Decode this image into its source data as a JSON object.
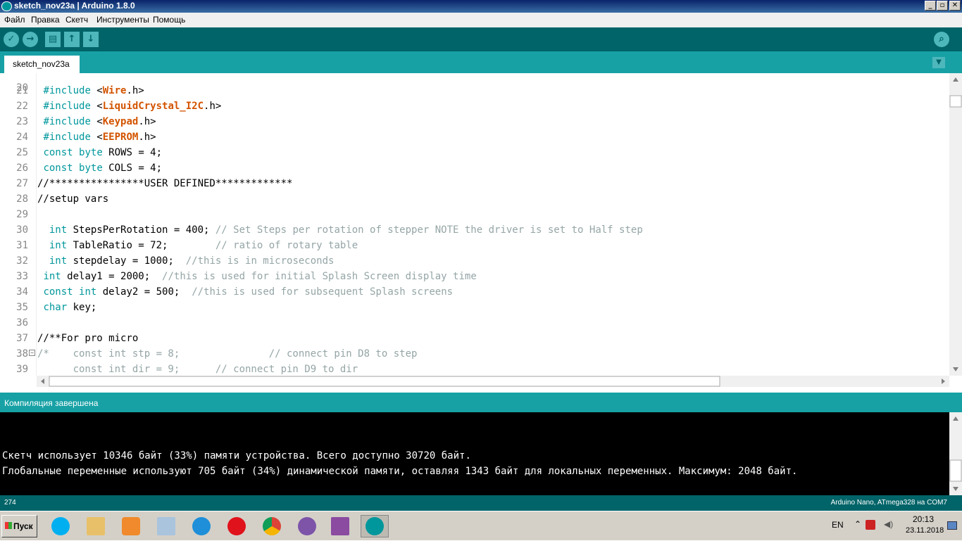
{
  "window": {
    "title": "sketch_nov23a | Arduino 1.8.0"
  },
  "menu": [
    "Файл",
    "Правка",
    "Скетч",
    "Инструменты",
    "Помощь"
  ],
  "toolbar": {
    "buttons": [
      "verify-icon",
      "upload-icon",
      "new-icon",
      "open-icon",
      "save-icon"
    ],
    "serial_monitor_icon": "magnifier-icon"
  },
  "tabs": {
    "active": "sketch_nov23a"
  },
  "editor": {
    "partial_top_line": "20",
    "lines": [
      {
        "n": "21",
        "code": " #include <Wire.h>"
      },
      {
        "n": "22",
        "code": " #include <LiquidCrystal_I2C.h>"
      },
      {
        "n": "23",
        "code": " #include <Keypad.h>"
      },
      {
        "n": "24",
        "code": " #include <EEPROM.h>"
      },
      {
        "n": "25",
        "code": " const byte ROWS = 4;"
      },
      {
        "n": "26",
        "code": " const byte COLS = 4;"
      },
      {
        "n": "27",
        "code": "//****************USER DEFINED*************"
      },
      {
        "n": "28",
        "code": "//setup vars"
      },
      {
        "n": "29",
        "code": ""
      },
      {
        "n": "30",
        "code": "  int StepsPerRotation = 400; // Set Steps per rotation of stepper NOTE the driver is set to Half step"
      },
      {
        "n": "31",
        "code": "  int TableRatio = 72;        // ratio of rotary table"
      },
      {
        "n": "32",
        "code": "  int stepdelay = 1000;  //this is in microseconds"
      },
      {
        "n": "33",
        "code": " int delay1 = 2000;  //this is used for initial Splash Screen display time"
      },
      {
        "n": "34",
        "code": " const int delay2 = 500;  //this is used for subsequent Splash screens"
      },
      {
        "n": "35",
        "code": " char key;"
      },
      {
        "n": "36",
        "code": ""
      },
      {
        "n": "37",
        "code": "//**For pro micro"
      },
      {
        "n": "38",
        "code": "/*    const int stp = 8;               // connect pin D8 to step"
      },
      {
        "n": "39",
        "code": "      const int dir = 9;      // connect pin D9 to dir"
      }
    ]
  },
  "status": {
    "message": "Компиляция завершена"
  },
  "console": {
    "lines": [
      "Скетч использует 10346 байт (33%) памяти устройства. Всего доступно 30720 байт.",
      "Глобальные переменные используют 705 байт (34%) динамической памяти, оставляя 1343 байт для локальных переменных. Максимум: 2048 байт."
    ]
  },
  "footer": {
    "line_number": "274",
    "board": "Arduino Nano, ATmega328 на COM7"
  },
  "taskbar": {
    "start_label": "Пуск",
    "apps": [
      "skype-icon",
      "folder-icon",
      "media-player-icon",
      "notepad-icon",
      "internet-explorer-icon",
      "opera-icon",
      "chrome-icon",
      "viber-icon",
      "winrar-icon",
      "arduino-icon"
    ],
    "lang": "EN",
    "time": "20:13",
    "date": "23.11.2018"
  }
}
